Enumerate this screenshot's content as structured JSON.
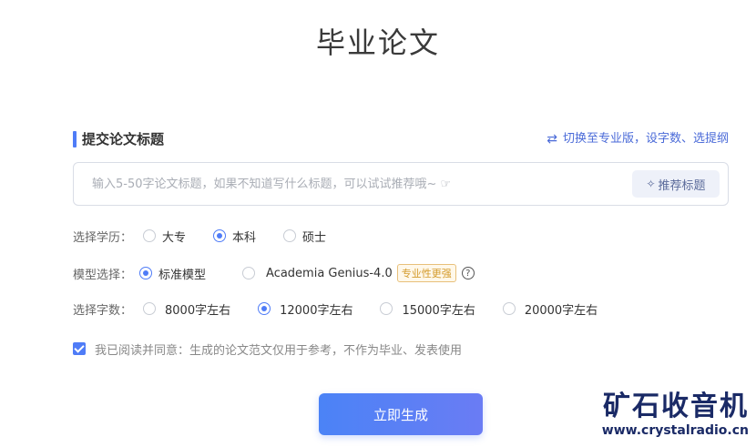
{
  "page": {
    "title": "毕业论文"
  },
  "section": {
    "title": "提交论文标题",
    "switch_label": "切换至专业版，设字数、选提纲",
    "switch_icon": "swap-icon"
  },
  "title_input": {
    "placeholder": "输入5-50字论文标题，如果不知道写什么标题，可以试试推荐哦~ ☞",
    "value": ""
  },
  "recommend_button": {
    "label": "推荐标题",
    "icon": "sparkle-icon"
  },
  "education": {
    "label": "选择学历：",
    "options": [
      "大专",
      "本科",
      "硕士"
    ],
    "selected": "本科"
  },
  "model": {
    "label": "模型选择：",
    "options": [
      "标准模型",
      "Academia Genius-4.0"
    ],
    "selected": "标准模型",
    "badge": "专业性更强",
    "help_icon": "help-circle-icon"
  },
  "word_count": {
    "label": "选择字数：",
    "options": [
      "8000字左右",
      "12000字左右",
      "15000字左右",
      "20000字左右"
    ],
    "selected": "12000字左右"
  },
  "agreement": {
    "checked": true,
    "text": "我已阅读并同意：生成的论文范文仅用于参考，不作为毕业、发表使用"
  },
  "generate_button": {
    "label": "立即生成"
  },
  "watermark": {
    "title": "矿石收音机",
    "url": "www.crystalradio.cn"
  },
  "colors": {
    "accent": "#4f7cf7",
    "badge": "#d39a2a",
    "watermark": "#1a2a66"
  }
}
